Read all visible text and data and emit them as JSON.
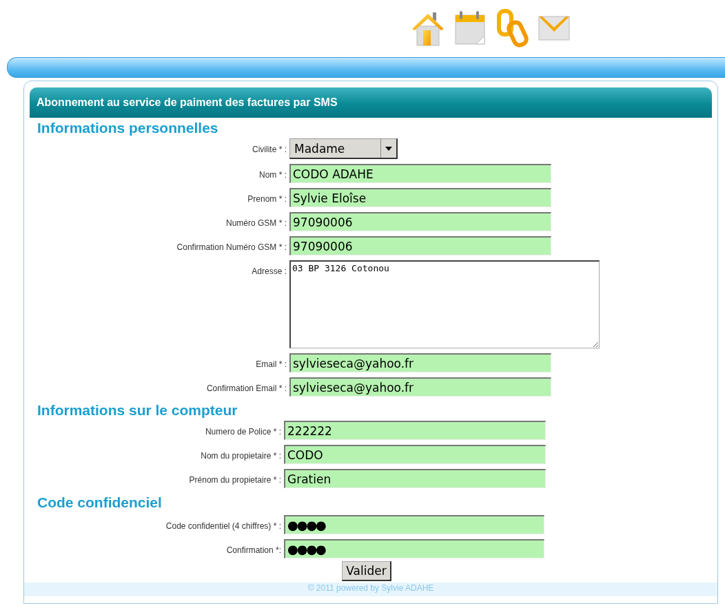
{
  "nav_icons": [
    {
      "kind": "home"
    },
    {
      "kind": "calendar"
    },
    {
      "kind": "links"
    },
    {
      "kind": "mail"
    }
  ],
  "panel": {
    "title": "Abonnement au service de paiment des factures par SMS"
  },
  "sections": [
    {
      "heading": "Informations personnelles",
      "fields": [
        {
          "kind": "select",
          "label": "Civilite * :",
          "value": "Madame"
        },
        {
          "kind": "text",
          "label": "Nom * :",
          "value": "CODO ADAHE"
        },
        {
          "kind": "text",
          "label": "Prenom * :",
          "value": "Sylvie Eloîse"
        },
        {
          "kind": "text",
          "label": "Numéro GSM * :",
          "value": "97090006"
        },
        {
          "kind": "text",
          "label": "Confirmation Numéro GSM * :",
          "value": "97090006"
        },
        {
          "kind": "textarea",
          "label": "Adresse :",
          "value": "03 BP 3126 Cotonou"
        },
        {
          "kind": "text",
          "label": "Email * :",
          "value": "sylvieseca@yahoo.fr"
        },
        {
          "kind": "text",
          "label": "Confirmation Email * :",
          "value": "sylvieseca@yahoo.fr"
        }
      ]
    },
    {
      "heading": "Informations sur le compteur",
      "fields": [
        {
          "kind": "text",
          "label": "Numero de Police * :",
          "value": "222222"
        },
        {
          "kind": "text",
          "label": "Nom du propietaire * :",
          "value": "CODO"
        },
        {
          "kind": "text",
          "label": "Prénom du propietaire * :",
          "value": "Gratien"
        }
      ]
    },
    {
      "heading": "Code confidenciel",
      "fields": [
        {
          "kind": "password",
          "label": "Code confidentiel (4 chiffres) * :",
          "value": "●●●●"
        },
        {
          "kind": "password",
          "label": "Confirmation *:",
          "value": "●●●●"
        }
      ]
    }
  ],
  "submit_button": "Valider",
  "footer": "© 2011  powered by Sylvie ADAHE"
}
